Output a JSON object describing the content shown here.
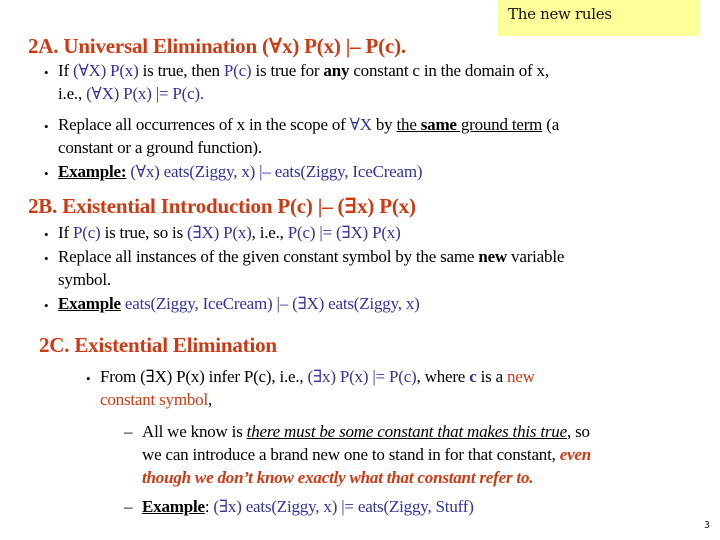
{
  "note_box": {
    "label": "The new rules",
    "color": "#ffff99"
  },
  "colors": {
    "heading": "#cc3a14",
    "logic": "#333399",
    "text": "#000000"
  },
  "section_2a": {
    "heading": "2A. Universal Elimination (∀x) P(x) |– P(c).",
    "bullet1": {
      "p1": "If ",
      "l1": "(∀X) P(x)",
      "p2": " is true, then ",
      "l2": "P(c)",
      "p3": " is true for ",
      "bold": "any",
      "p4": " constant c in the domain of x,",
      "line2_prefix": "i.e., ",
      "l3": "(∀X) P(x) |= P(c)."
    },
    "bullet2": {
      "p1": "Replace all occurrences of x in the scope of ",
      "l1": "∀X",
      "p2": " by ",
      "u1": "the ",
      "ub": "same",
      "u2": " ground term",
      "p3": " (a",
      "line2": "constant or a ground function)."
    },
    "bullet3": {
      "label": "Example:",
      "text": " (∀x) eats(Ziggy, x) |– eats(Ziggy, IceCream)"
    }
  },
  "section_2b": {
    "heading": "2B. Existential Introduction P(c) |– (∃x) P(x)",
    "bullet1": {
      "p1": "If ",
      "l1": "P(c)",
      "p2": " is true, so is ",
      "l2": "(∃X) P(x)",
      "p3": ", i.e., ",
      "l3": "P(c) |= (∃X) P(x)"
    },
    "bullet2": {
      "p1": "Replace all instances of the given constant symbol by the same ",
      "bold": "new",
      "p2": " variable",
      "line2": "symbol."
    },
    "bullet3": {
      "label": "Example",
      "text": " eats(Ziggy, IceCream) |– (∃X) eats(Ziggy, x)"
    }
  },
  "section_2c": {
    "heading": "2C. Existential Elimination",
    "bullet1": {
      "p1": "From (∃X) P(x) infer P(c), i.e., ",
      "l1": "(∃x) P(x) |= P(c)",
      "p2": ", where ",
      "l2": "c",
      "p3": " is a ",
      "r1": "new",
      "line2_red": "constant symbol",
      "line2_end": ","
    },
    "sub1": {
      "p1": "All we know is ",
      "ui": "there must be some constant that makes this true",
      "p2": ", so",
      "line2": "we can introduce a brand new one to stand in for that constant, ",
      "r1": "even",
      "line3_red": "though we don’t know exactly what that constant refer to."
    },
    "sub2": {
      "label": "Example",
      "colon": ": ",
      "text": "(∃x) eats(Ziggy, x) |= eats(Ziggy, Stuff)"
    }
  },
  "page_number": "3"
}
